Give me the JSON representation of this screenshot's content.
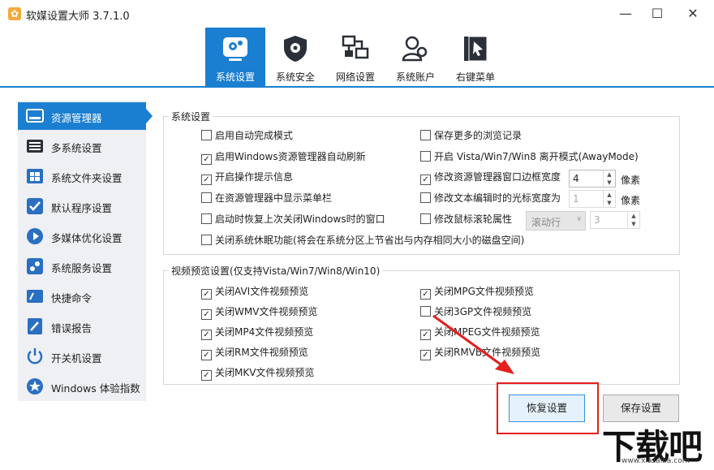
{
  "window": {
    "title": "软媒设置大师 3.7.1.0",
    "controls": {
      "minimize": "—",
      "maximize": "☐",
      "close": "✕"
    }
  },
  "topnav": {
    "tabs": [
      {
        "label": "系统设置",
        "icon": "gear-screen-icon",
        "active": true
      },
      {
        "label": "系统安全",
        "icon": "shield-icon",
        "active": false
      },
      {
        "label": "网络设置",
        "icon": "network-icon",
        "active": false
      },
      {
        "label": "系统账户",
        "icon": "users-icon",
        "active": false
      },
      {
        "label": "右键菜单",
        "icon": "context-menu-icon",
        "active": false
      }
    ]
  },
  "sidebar": {
    "items": [
      {
        "label": "资源管理器",
        "icon": "explorer-icon",
        "active": true
      },
      {
        "label": "多系统设置",
        "icon": "multi-system-icon"
      },
      {
        "label": "系统文件夹设置",
        "icon": "windows-folder-icon"
      },
      {
        "label": "默认程序设置",
        "icon": "default-program-icon"
      },
      {
        "label": "多媒体优化设置",
        "icon": "media-icon"
      },
      {
        "label": "系统服务设置",
        "icon": "service-icon"
      },
      {
        "label": "快捷命令",
        "icon": "command-icon"
      },
      {
        "label": "错误报告",
        "icon": "error-report-icon"
      },
      {
        "label": "开关机设置",
        "icon": "power-icon"
      },
      {
        "label": "Windows 体验指数",
        "icon": "star-icon"
      }
    ]
  },
  "system_group": {
    "title": "系统设置",
    "left": [
      {
        "label": "启用自动完成模式",
        "checked": false
      },
      {
        "label": "启用Windows资源管理器自动刷新",
        "checked": true
      },
      {
        "label": "开启操作提示信息",
        "checked": true
      },
      {
        "label": "在资源管理器中显示菜单栏",
        "checked": false
      },
      {
        "label": "启动时恢复上次关闭Windows时的窗口",
        "checked": false
      },
      {
        "label": "关闭系统休眠功能(将会在系统分区上节省出与内存相同大小的磁盘空间)",
        "checked": false
      }
    ],
    "right": [
      {
        "label": "保存更多的浏览记录",
        "checked": false
      },
      {
        "label": "开启 Vista/Win7/Win8 离开模式(AwayMode)",
        "checked": false
      },
      {
        "label": "修改资源管理器窗口边框宽度",
        "checked": true
      },
      {
        "label": "修改文本编辑时的光标宽度为",
        "checked": false
      },
      {
        "label": "修改鼠标滚轮属性",
        "checked": false
      }
    ],
    "border_width": {
      "value": "4",
      "unit": "像素"
    },
    "cursor_width": {
      "value": "1",
      "unit": "像素"
    },
    "wheel_mode": {
      "value": "滚动行"
    },
    "wheel_lines": {
      "value": "3"
    }
  },
  "video_group": {
    "title": "视频预览设置(仅支持Vista/Win7/Win8/Win10)",
    "left": [
      {
        "label": "关闭AVI文件视频预览",
        "checked": true
      },
      {
        "label": "关闭WMV文件视频预览",
        "checked": true
      },
      {
        "label": "关闭MP4文件视频预览",
        "checked": true
      },
      {
        "label": "关闭RM文件视频预览",
        "checked": true
      },
      {
        "label": "关闭MKV文件视频预览",
        "checked": true
      }
    ],
    "right": [
      {
        "label": "关闭MPG文件视频预览",
        "checked": true
      },
      {
        "label": "关闭3GP文件视频预览",
        "checked": false
      },
      {
        "label": "关闭MPEG文件视频预览",
        "checked": true
      },
      {
        "label": "关闭RMVB文件视频预览",
        "checked": true
      }
    ]
  },
  "buttons": {
    "restore": "恢复设置",
    "save": "保存设置"
  },
  "watermark": {
    "text": "下载吧",
    "url": "www.xiazaiba.com"
  },
  "colors": {
    "accent": "#1b7fd1",
    "highlight": "#e61e1e"
  }
}
